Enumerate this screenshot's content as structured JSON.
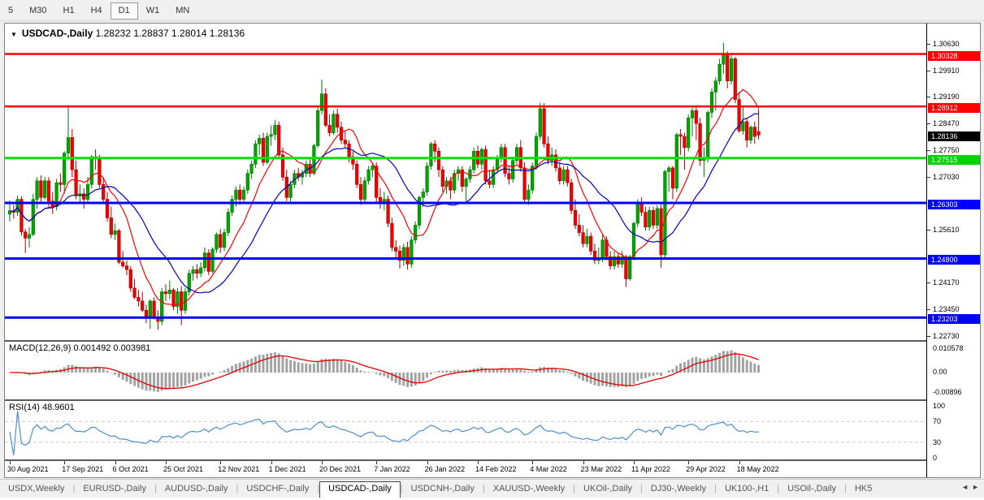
{
  "toolbar": {
    "timeframes": [
      "5",
      "M30",
      "H1",
      "H4",
      "D1",
      "W1",
      "MN"
    ],
    "active_timeframe": "D1"
  },
  "chart_header": {
    "dropdown_icon": "▼",
    "symbol": "USDCAD-,Daily",
    "ohlc_text": "1.28232 1.28837 1.28014 1.28136"
  },
  "chart_data": {
    "type": "candlestick",
    "symbol": "USDCAD",
    "timeframe": "Daily",
    "y_range": [
      1.2266,
      1.3113
    ],
    "price_axis_ticks": [
      {
        "label": "1.30630",
        "value": 1.3063
      },
      {
        "label": "1.29910",
        "value": 1.2991
      },
      {
        "label": "1.29190",
        "value": 1.2919
      },
      {
        "label": "1.28470",
        "value": 1.2847
      },
      {
        "label": "1.27750",
        "value": 1.2775
      },
      {
        "label": "1.27030",
        "value": 1.2703
      },
      {
        "label": "1.25610",
        "value": 1.2561
      },
      {
        "label": "1.24170",
        "value": 1.2417
      },
      {
        "label": "1.23450",
        "value": 1.2345
      },
      {
        "label": "1.22730",
        "value": 1.2273
      }
    ],
    "level_lines": [
      {
        "label": "1.30328",
        "value": 1.30328,
        "color": "#ff0000",
        "width": 2.5
      },
      {
        "label": "1.28912",
        "value": 1.28912,
        "color": "#ff0000",
        "width": 2.5
      },
      {
        "label": "1.27515",
        "value": 1.27515,
        "color": "#00e400",
        "width": 3
      },
      {
        "label": "1.26303",
        "value": 1.26303,
        "color": "#0000ff",
        "width": 3
      },
      {
        "label": "1.24800",
        "value": 1.248,
        "color": "#0000ff",
        "width": 3
      },
      {
        "label": "1.23203",
        "value": 1.23203,
        "color": "#0000ff",
        "width": 3
      }
    ],
    "current_price": {
      "label": "1.28136",
      "value": 1.28136,
      "badge_color": "#000000"
    },
    "x_labels": [
      {
        "label": "30 Aug 2021",
        "index": 0
      },
      {
        "label": "17 Sep 2021",
        "index": 14
      },
      {
        "label": "6 Oct 2021",
        "index": 27
      },
      {
        "label": "25 Oct 2021",
        "index": 40
      },
      {
        "label": "12 Nov 2021",
        "index": 54
      },
      {
        "label": "1 Dec 2021",
        "index": 67
      },
      {
        "label": "20 Dec 2021",
        "index": 80
      },
      {
        "label": "7 Jan 2022",
        "index": 94
      },
      {
        "label": "26 Jan 2022",
        "index": 107
      },
      {
        "label": "14 Feb 2022",
        "index": 120
      },
      {
        "label": "4 Mar 2022",
        "index": 134
      },
      {
        "label": "23 Mar 2022",
        "index": 147
      },
      {
        "label": "11 Apr 2022",
        "index": 160
      },
      {
        "label": "29 Apr 2022",
        "index": 174
      },
      {
        "label": "18 May 2022",
        "index": 187
      }
    ],
    "candles": [
      [
        1.26,
        1.2637,
        1.258,
        1.2609
      ],
      [
        1.2609,
        1.2625,
        1.2588,
        1.2605
      ],
      [
        1.2605,
        1.265,
        1.2595,
        1.264
      ],
      [
        1.264,
        1.2648,
        1.2542,
        1.2552
      ],
      [
        1.2552,
        1.256,
        1.2495,
        1.2535
      ],
      [
        1.2535,
        1.2565,
        1.251,
        1.2545
      ],
      [
        1.2545,
        1.2655,
        1.254,
        1.264
      ],
      [
        1.264,
        1.27,
        1.2615,
        1.269
      ],
      [
        1.269,
        1.2705,
        1.263,
        1.2645
      ],
      [
        1.2645,
        1.27,
        1.264,
        1.269
      ],
      [
        1.269,
        1.27,
        1.2615,
        1.2635
      ],
      [
        1.2635,
        1.266,
        1.26,
        1.262
      ],
      [
        1.262,
        1.2695,
        1.261,
        1.2685
      ],
      [
        1.2685,
        1.271,
        1.266,
        1.268
      ],
      [
        1.268,
        1.277,
        1.2655,
        1.2765
      ],
      [
        1.2765,
        1.2895,
        1.2745,
        1.2807
      ],
      [
        1.2807,
        1.283,
        1.27,
        1.272
      ],
      [
        1.272,
        1.2745,
        1.264,
        1.265
      ],
      [
        1.265,
        1.268,
        1.263,
        1.2655
      ],
      [
        1.2655,
        1.267,
        1.2615,
        1.264
      ],
      [
        1.264,
        1.27,
        1.263,
        1.268
      ],
      [
        1.268,
        1.276,
        1.267,
        1.2755
      ],
      [
        1.2755,
        1.2775,
        1.272,
        1.275
      ],
      [
        1.275,
        1.276,
        1.267,
        1.268
      ],
      [
        1.268,
        1.27,
        1.263,
        1.264
      ],
      [
        1.264,
        1.266,
        1.258,
        1.259
      ],
      [
        1.259,
        1.262,
        1.2535,
        1.2545
      ],
      [
        1.2545,
        1.2575,
        1.253,
        1.2555
      ],
      [
        1.2555,
        1.256,
        1.2465,
        1.247
      ],
      [
        1.247,
        1.25,
        1.2455,
        1.246
      ],
      [
        1.246,
        1.2475,
        1.2435,
        1.245
      ],
      [
        1.245,
        1.246,
        1.239,
        1.24
      ],
      [
        1.24,
        1.2425,
        1.237,
        1.2375
      ],
      [
        1.2375,
        1.2395,
        1.235,
        1.2365
      ],
      [
        1.2365,
        1.239,
        1.2335,
        1.234
      ],
      [
        1.234,
        1.2355,
        1.2305,
        1.232
      ],
      [
        1.232,
        1.237,
        1.229,
        1.2365
      ],
      [
        1.2365,
        1.2375,
        1.2315,
        1.232
      ],
      [
        1.232,
        1.234,
        1.2288,
        1.231
      ],
      [
        1.231,
        1.24,
        1.23,
        1.239
      ],
      [
        1.239,
        1.241,
        1.2365,
        1.2385
      ],
      [
        1.2385,
        1.242,
        1.237,
        1.2395
      ],
      [
        1.2395,
        1.24,
        1.234,
        1.235
      ],
      [
        1.235,
        1.24,
        1.233,
        1.239
      ],
      [
        1.239,
        1.2405,
        1.23,
        1.234
      ],
      [
        1.234,
        1.24,
        1.233,
        1.239
      ],
      [
        1.239,
        1.245,
        1.238,
        1.244
      ],
      [
        1.244,
        1.246,
        1.242,
        1.245
      ],
      [
        1.245,
        1.2465,
        1.2425,
        1.244
      ],
      [
        1.244,
        1.247,
        1.243,
        1.2455
      ],
      [
        1.2455,
        1.251,
        1.2445,
        1.2495
      ],
      [
        1.2495,
        1.2505,
        1.2435,
        1.2445
      ],
      [
        1.2445,
        1.251,
        1.244,
        1.2505
      ],
      [
        1.2505,
        1.255,
        1.2495,
        1.2545
      ],
      [
        1.2545,
        1.256,
        1.2495,
        1.251
      ],
      [
        1.251,
        1.256,
        1.25,
        1.255
      ],
      [
        1.255,
        1.2615,
        1.254,
        1.2605
      ],
      [
        1.2605,
        1.265,
        1.2595,
        1.264
      ],
      [
        1.264,
        1.2675,
        1.262,
        1.2665
      ],
      [
        1.2665,
        1.268,
        1.2625,
        1.264
      ],
      [
        1.264,
        1.2675,
        1.263,
        1.2665
      ],
      [
        1.2665,
        1.272,
        1.2655,
        1.271
      ],
      [
        1.271,
        1.2745,
        1.2695,
        1.2735
      ],
      [
        1.2735,
        1.28,
        1.2725,
        1.279
      ],
      [
        1.279,
        1.2815,
        1.276,
        1.2805
      ],
      [
        1.2805,
        1.282,
        1.273,
        1.274
      ],
      [
        1.274,
        1.282,
        1.2735,
        1.281
      ],
      [
        1.281,
        1.284,
        1.2785,
        1.2815
      ],
      [
        1.2815,
        1.2855,
        1.28,
        1.284
      ],
      [
        1.284,
        1.285,
        1.275,
        1.276
      ],
      [
        1.276,
        1.278,
        1.269,
        1.27
      ],
      [
        1.27,
        1.272,
        1.2635,
        1.2645
      ],
      [
        1.2645,
        1.269,
        1.263,
        1.268
      ],
      [
        1.268,
        1.272,
        1.267,
        1.271
      ],
      [
        1.271,
        1.2725,
        1.269,
        1.27
      ],
      [
        1.27,
        1.272,
        1.268,
        1.271
      ],
      [
        1.271,
        1.2745,
        1.27,
        1.2735
      ],
      [
        1.2735,
        1.275,
        1.27,
        1.271
      ],
      [
        1.271,
        1.279,
        1.2705,
        1.2785
      ],
      [
        1.2785,
        1.289,
        1.278,
        1.288
      ],
      [
        1.288,
        1.2964,
        1.287,
        1.2925
      ],
      [
        1.2925,
        1.294,
        1.2835,
        1.284
      ],
      [
        1.284,
        1.287,
        1.281,
        1.282
      ],
      [
        1.282,
        1.288,
        1.2815,
        1.287
      ],
      [
        1.287,
        1.2885,
        1.282,
        1.2835
      ],
      [
        1.2835,
        1.285,
        1.279,
        1.28
      ],
      [
        1.28,
        1.2825,
        1.278,
        1.279
      ],
      [
        1.279,
        1.28,
        1.274,
        1.2755
      ],
      [
        1.2755,
        1.277,
        1.272,
        1.2735
      ],
      [
        1.2735,
        1.2745,
        1.267,
        1.268
      ],
      [
        1.268,
        1.27,
        1.2625,
        1.264
      ],
      [
        1.264,
        1.27,
        1.263,
        1.269
      ],
      [
        1.269,
        1.273,
        1.268,
        1.272
      ],
      [
        1.272,
        1.274,
        1.27,
        1.273
      ],
      [
        1.273,
        1.274,
        1.263,
        1.2645
      ],
      [
        1.2645,
        1.267,
        1.2615,
        1.263
      ],
      [
        1.263,
        1.266,
        1.261,
        1.264
      ],
      [
        1.264,
        1.265,
        1.2565,
        1.2575
      ],
      [
        1.2575,
        1.259,
        1.25,
        1.251
      ],
      [
        1.251,
        1.253,
        1.248,
        1.25
      ],
      [
        1.25,
        1.2515,
        1.2453,
        1.2475
      ],
      [
        1.2475,
        1.252,
        1.246,
        1.251
      ],
      [
        1.251,
        1.2525,
        1.245,
        1.2465
      ],
      [
        1.2465,
        1.254,
        1.2455,
        1.253
      ],
      [
        1.253,
        1.258,
        1.252,
        1.257
      ],
      [
        1.257,
        1.265,
        1.256,
        1.2645
      ],
      [
        1.2645,
        1.267,
        1.262,
        1.266
      ],
      [
        1.266,
        1.274,
        1.265,
        1.273
      ],
      [
        1.273,
        1.2795,
        1.272,
        1.279
      ],
      [
        1.279,
        1.28,
        1.274,
        1.277
      ],
      [
        1.277,
        1.278,
        1.27,
        1.272
      ],
      [
        1.272,
        1.273,
        1.266,
        1.2675
      ],
      [
        1.2675,
        1.27,
        1.2655,
        1.269
      ],
      [
        1.269,
        1.27,
        1.264,
        1.2665
      ],
      [
        1.2665,
        1.272,
        1.2655,
        1.271
      ],
      [
        1.271,
        1.273,
        1.269,
        1.272
      ],
      [
        1.272,
        1.273,
        1.266,
        1.2675
      ],
      [
        1.2675,
        1.27,
        1.2635,
        1.2695
      ],
      [
        1.2695,
        1.273,
        1.2685,
        1.272
      ],
      [
        1.272,
        1.278,
        1.271,
        1.277
      ],
      [
        1.277,
        1.2785,
        1.2725,
        1.2735
      ],
      [
        1.2735,
        1.278,
        1.272,
        1.2775
      ],
      [
        1.2775,
        1.2785,
        1.268,
        1.269
      ],
      [
        1.269,
        1.272,
        1.267,
        1.268
      ],
      [
        1.268,
        1.273,
        1.267,
        1.272
      ],
      [
        1.272,
        1.276,
        1.271,
        1.275
      ],
      [
        1.275,
        1.279,
        1.274,
        1.278
      ],
      [
        1.278,
        1.279,
        1.27,
        1.271
      ],
      [
        1.271,
        1.273,
        1.268,
        1.2695
      ],
      [
        1.2695,
        1.275,
        1.2685,
        1.2745
      ],
      [
        1.2745,
        1.279,
        1.2735,
        1.278
      ],
      [
        1.278,
        1.28,
        1.2715,
        1.2725
      ],
      [
        1.2725,
        1.274,
        1.263,
        1.264
      ],
      [
        1.264,
        1.268,
        1.2625,
        1.2665
      ],
      [
        1.2665,
        1.274,
        1.2655,
        1.273
      ],
      [
        1.273,
        1.282,
        1.272,
        1.281
      ],
      [
        1.281,
        1.2901,
        1.28,
        1.2885
      ],
      [
        1.2885,
        1.29,
        1.278,
        1.279
      ],
      [
        1.279,
        1.281,
        1.2735,
        1.2745
      ],
      [
        1.2745,
        1.278,
        1.273,
        1.276
      ],
      [
        1.276,
        1.2775,
        1.2715,
        1.2725
      ],
      [
        1.2725,
        1.274,
        1.268,
        1.269
      ],
      [
        1.269,
        1.273,
        1.268,
        1.272
      ],
      [
        1.272,
        1.273,
        1.2675,
        1.2685
      ],
      [
        1.2685,
        1.2695,
        1.26,
        1.261
      ],
      [
        1.261,
        1.264,
        1.256,
        1.257
      ],
      [
        1.257,
        1.26,
        1.254,
        1.255
      ],
      [
        1.255,
        1.257,
        1.251,
        1.252
      ],
      [
        1.252,
        1.256,
        1.251,
        1.254
      ],
      [
        1.254,
        1.255,
        1.249,
        1.25
      ],
      [
        1.25,
        1.252,
        1.2465,
        1.2475
      ],
      [
        1.2475,
        1.251,
        1.2465,
        1.248
      ],
      [
        1.248,
        1.2545,
        1.247,
        1.253
      ],
      [
        1.253,
        1.254,
        1.2475,
        1.2485
      ],
      [
        1.2485,
        1.25,
        1.245,
        1.246
      ],
      [
        1.246,
        1.25,
        1.245,
        1.2485
      ],
      [
        1.2485,
        1.2495,
        1.2455,
        1.2465
      ],
      [
        1.2465,
        1.25,
        1.2455,
        1.2485
      ],
      [
        1.2485,
        1.249,
        1.2403,
        1.2425
      ],
      [
        1.2425,
        1.249,
        1.242,
        1.2485
      ],
      [
        1.2485,
        1.258,
        1.2475,
        1.2575
      ],
      [
        1.2575,
        1.264,
        1.2565,
        1.263
      ],
      [
        1.263,
        1.2645,
        1.2595,
        1.2605
      ],
      [
        1.2605,
        1.262,
        1.2555,
        1.2565
      ],
      [
        1.2565,
        1.262,
        1.2555,
        1.261
      ],
      [
        1.261,
        1.262,
        1.256,
        1.257
      ],
      [
        1.257,
        1.2625,
        1.256,
        1.2615
      ],
      [
        1.2615,
        1.263,
        1.2455,
        1.249
      ],
      [
        1.249,
        1.272,
        1.248,
        1.2715
      ],
      [
        1.2715,
        1.273,
        1.266,
        1.2725
      ],
      [
        1.2725,
        1.273,
        1.264,
        1.267
      ],
      [
        1.267,
        1.282,
        1.266,
        1.2815
      ],
      [
        1.2815,
        1.283,
        1.276,
        1.281
      ],
      [
        1.281,
        1.282,
        1.272,
        1.278
      ],
      [
        1.278,
        1.287,
        1.277,
        1.286
      ],
      [
        1.286,
        1.289,
        1.281,
        1.288
      ],
      [
        1.288,
        1.289,
        1.28,
        1.2845
      ],
      [
        1.2845,
        1.286,
        1.273,
        1.2745
      ],
      [
        1.2745,
        1.278,
        1.27,
        1.275
      ],
      [
        1.275,
        1.288,
        1.274,
        1.2875
      ],
      [
        1.2875,
        1.294,
        1.286,
        1.293
      ],
      [
        1.293,
        1.297,
        1.288,
        1.296
      ],
      [
        1.296,
        1.302,
        1.295,
        1.3005
      ],
      [
        1.3005,
        1.3063,
        1.298,
        1.3033
      ],
      [
        1.3033,
        1.304,
        1.294,
        1.296
      ],
      [
        1.296,
        1.303,
        1.295,
        1.302
      ],
      [
        1.302,
        1.3025,
        1.29,
        1.291
      ],
      [
        1.291,
        1.293,
        1.282,
        1.2825
      ],
      [
        1.2825,
        1.289,
        1.2815,
        1.285
      ],
      [
        1.285,
        1.286,
        1.278,
        1.28
      ],
      [
        1.28,
        1.284,
        1.279,
        1.2835
      ],
      [
        1.2835,
        1.285,
        1.279,
        1.281
      ],
      [
        1.28232,
        1.28837,
        1.28014,
        1.28136
      ]
    ],
    "moving_averages": [
      {
        "name": "fast-ma",
        "period": 10,
        "color": "#ff0000"
      },
      {
        "name": "slow-ma",
        "period": 21,
        "color": "#0000bb"
      }
    ],
    "colors": {
      "up_fill": "#00a500",
      "up_edge": "#007a00",
      "down_fill": "#f20000",
      "down_edge": "#aa0000"
    },
    "indicators": {
      "macd": {
        "label": "MACD(12,26,9)",
        "values_text": "0.001492 0.003981",
        "fast": 12,
        "slow": 26,
        "signal": 9,
        "axis_ticks": [
          "0.010578",
          "0.00",
          "-0.00896"
        ],
        "scale_max": 0.010578,
        "histogram_color": "#a2a2a2",
        "signal_color": "#e00000"
      },
      "rsi": {
        "label": "RSI(14)",
        "value_text": "48.9601",
        "period": 14,
        "axis_ticks": [
          "100",
          "70",
          "30",
          "0"
        ],
        "levels": [
          70,
          30
        ],
        "line_color": "#4c8fce",
        "level_color": "#c8c8c8"
      }
    }
  },
  "tabs": {
    "items": [
      "USDX,Weekly",
      "EURUSD-,Daily",
      "AUDUSD-,Daily",
      "USDCHF-,Daily",
      "USDCAD-,Daily",
      "USDCNH-,Daily",
      "XAUUSD-,Weekly",
      "UKOil-,Daily",
      "DJ30-,Weekly",
      "UK100-,H1",
      "USOil-,Daily",
      "HK5"
    ],
    "active": "USDCAD-,Daily",
    "left_arrow": "◄",
    "right_arrow": "►"
  }
}
